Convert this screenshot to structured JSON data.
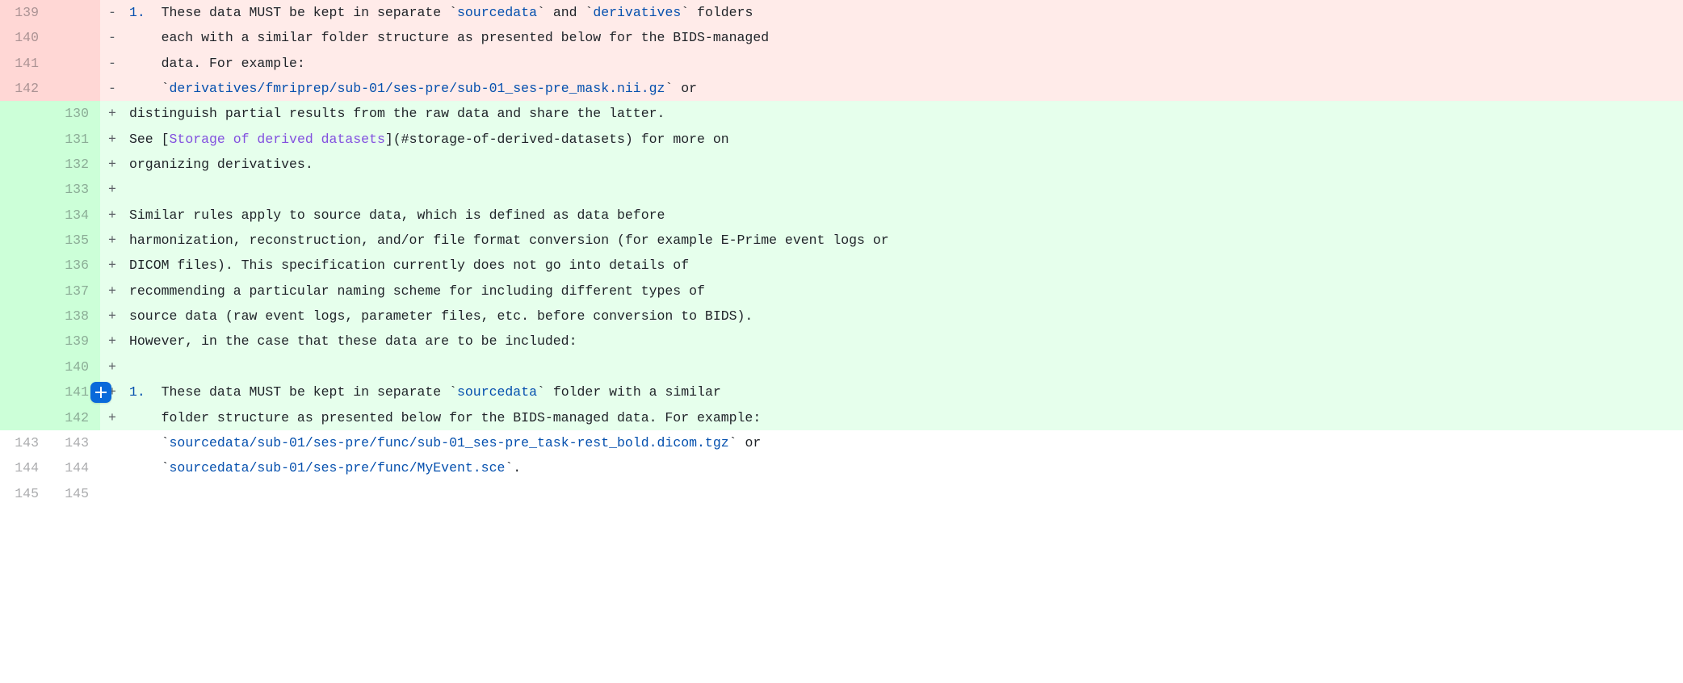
{
  "add_button_tooltip": "Add a comment",
  "rows": [
    {
      "type": "del",
      "old": "139",
      "new": "",
      "marker": "-",
      "segments": [
        {
          "cls": "tok-listnum",
          "text": "1."
        },
        {
          "cls": "",
          "text": "  These data MUST be kept in separate `"
        },
        {
          "cls": "tok-code",
          "text": "sourcedata"
        },
        {
          "cls": "",
          "text": "` and `"
        },
        {
          "cls": "tok-code",
          "text": "derivatives"
        },
        {
          "cls": "",
          "text": "` folders"
        }
      ]
    },
    {
      "type": "del",
      "old": "140",
      "new": "",
      "marker": "-",
      "segments": [
        {
          "cls": "",
          "text": "    each with a similar folder structure as presented below for the BIDS-managed"
        }
      ]
    },
    {
      "type": "del",
      "old": "141",
      "new": "",
      "marker": "-",
      "segments": [
        {
          "cls": "",
          "text": "    data. For example:"
        }
      ]
    },
    {
      "type": "del",
      "old": "142",
      "new": "",
      "marker": "-",
      "segments": [
        {
          "cls": "",
          "text": "    `"
        },
        {
          "cls": "tok-code",
          "text": "derivatives/fmriprep/sub-01/ses-pre/sub-01_ses-pre_mask.nii.gz"
        },
        {
          "cls": "",
          "text": "` or"
        }
      ]
    },
    {
      "type": "add",
      "old": "",
      "new": "130",
      "marker": "+",
      "segments": [
        {
          "cls": "",
          "text": "distinguish partial results from the raw data and share the latter."
        }
      ]
    },
    {
      "type": "add",
      "old": "",
      "new": "131",
      "marker": "+",
      "segments": [
        {
          "cls": "",
          "text": "See ["
        },
        {
          "cls": "tok-linktxt",
          "text": "Storage of derived datasets"
        },
        {
          "cls": "",
          "text": "](#storage-of-derived-datasets) for more on"
        }
      ]
    },
    {
      "type": "add",
      "old": "",
      "new": "132",
      "marker": "+",
      "segments": [
        {
          "cls": "",
          "text": "organizing derivatives."
        }
      ]
    },
    {
      "type": "add",
      "old": "",
      "new": "133",
      "marker": "+",
      "segments": []
    },
    {
      "type": "add",
      "old": "",
      "new": "134",
      "marker": "+",
      "segments": [
        {
          "cls": "",
          "text": "Similar rules apply to source data, which is defined as data before"
        }
      ]
    },
    {
      "type": "add",
      "old": "",
      "new": "135",
      "marker": "+",
      "segments": [
        {
          "cls": "",
          "text": "harmonization, reconstruction, and/or file format conversion (for example E-Prime event logs or"
        }
      ]
    },
    {
      "type": "add",
      "old": "",
      "new": "136",
      "marker": "+",
      "segments": [
        {
          "cls": "",
          "text": "DICOM files). This specification currently does not go into details of"
        }
      ]
    },
    {
      "type": "add",
      "old": "",
      "new": "137",
      "marker": "+",
      "segments": [
        {
          "cls": "",
          "text": "recommending a particular naming scheme for including different types of"
        }
      ]
    },
    {
      "type": "add",
      "old": "",
      "new": "138",
      "marker": "+",
      "segments": [
        {
          "cls": "",
          "text": "source data (raw event logs, parameter files, etc. before conversion to BIDS)."
        }
      ]
    },
    {
      "type": "add",
      "old": "",
      "new": "139",
      "marker": "+",
      "segments": [
        {
          "cls": "",
          "text": "However, in the case that these data are to be included:"
        }
      ]
    },
    {
      "type": "add",
      "old": "",
      "new": "140",
      "marker": "+",
      "segments": []
    },
    {
      "type": "add",
      "old": "",
      "new": "141",
      "marker": "+",
      "has_add_button": true,
      "segments": [
        {
          "cls": "tok-listnum",
          "text": "1."
        },
        {
          "cls": "",
          "text": "  These data MUST be kept in separate `"
        },
        {
          "cls": "tok-code",
          "text": "sourcedata"
        },
        {
          "cls": "",
          "text": "` folder with a similar"
        }
      ]
    },
    {
      "type": "add",
      "old": "",
      "new": "142",
      "marker": "+",
      "segments": [
        {
          "cls": "",
          "text": "    folder structure as presented below for the BIDS-managed data. For example:"
        }
      ]
    },
    {
      "type": "ctx",
      "old": "143",
      "new": "143",
      "marker": "",
      "segments": [
        {
          "cls": "",
          "text": "    `"
        },
        {
          "cls": "tok-code",
          "text": "sourcedata/sub-01/ses-pre/func/sub-01_ses-pre_task-rest_bold.dicom.tgz"
        },
        {
          "cls": "",
          "text": "` or"
        }
      ]
    },
    {
      "type": "ctx",
      "old": "144",
      "new": "144",
      "marker": "",
      "segments": [
        {
          "cls": "",
          "text": "    `"
        },
        {
          "cls": "tok-code",
          "text": "sourcedata/sub-01/ses-pre/func/MyEvent.sce"
        },
        {
          "cls": "",
          "text": "`."
        }
      ]
    },
    {
      "type": "ctx",
      "old": "145",
      "new": "145",
      "marker": "",
      "segments": []
    }
  ]
}
